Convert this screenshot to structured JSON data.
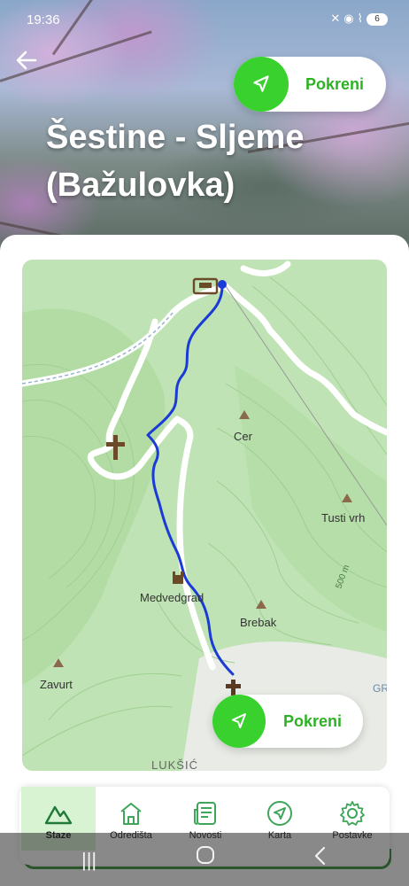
{
  "status_bar": {
    "time": "19:36",
    "icons": [
      "mute-icon",
      "location-icon",
      "wifi-icon",
      "battery-icon"
    ],
    "battery": "6"
  },
  "header": {
    "title_line1": "Šestine - Sljeme",
    "title_line2": "(Bažulovka)",
    "start_label": "Pokreni"
  },
  "map": {
    "start_label": "Pokreni",
    "labels": {
      "cer": "Cer",
      "tusti_vrh": "Tusti vrh",
      "medvedgrad": "Medvedgrad",
      "brebak": "Brebak",
      "zavurt": "Zavurt",
      "luksic": "LUKŠIĆ",
      "elevation": "500 m",
      "gr": "GR"
    },
    "route_color": "#1b3bd6"
  },
  "bottom_nav": {
    "items": [
      {
        "label": "Staze",
        "icon": "mountain-icon",
        "active": true
      },
      {
        "label": "Odredišta",
        "icon": "building-icon",
        "active": false
      },
      {
        "label": "Novosti",
        "icon": "news-icon",
        "active": false
      },
      {
        "label": "Karta",
        "icon": "navigation-icon",
        "active": false
      },
      {
        "label": "Postavke",
        "icon": "gear-icon",
        "active": false
      }
    ]
  },
  "colors": {
    "accent": "#39d12e",
    "accent_text": "#2db224",
    "nav_active_bg": "#d7f3d2"
  }
}
